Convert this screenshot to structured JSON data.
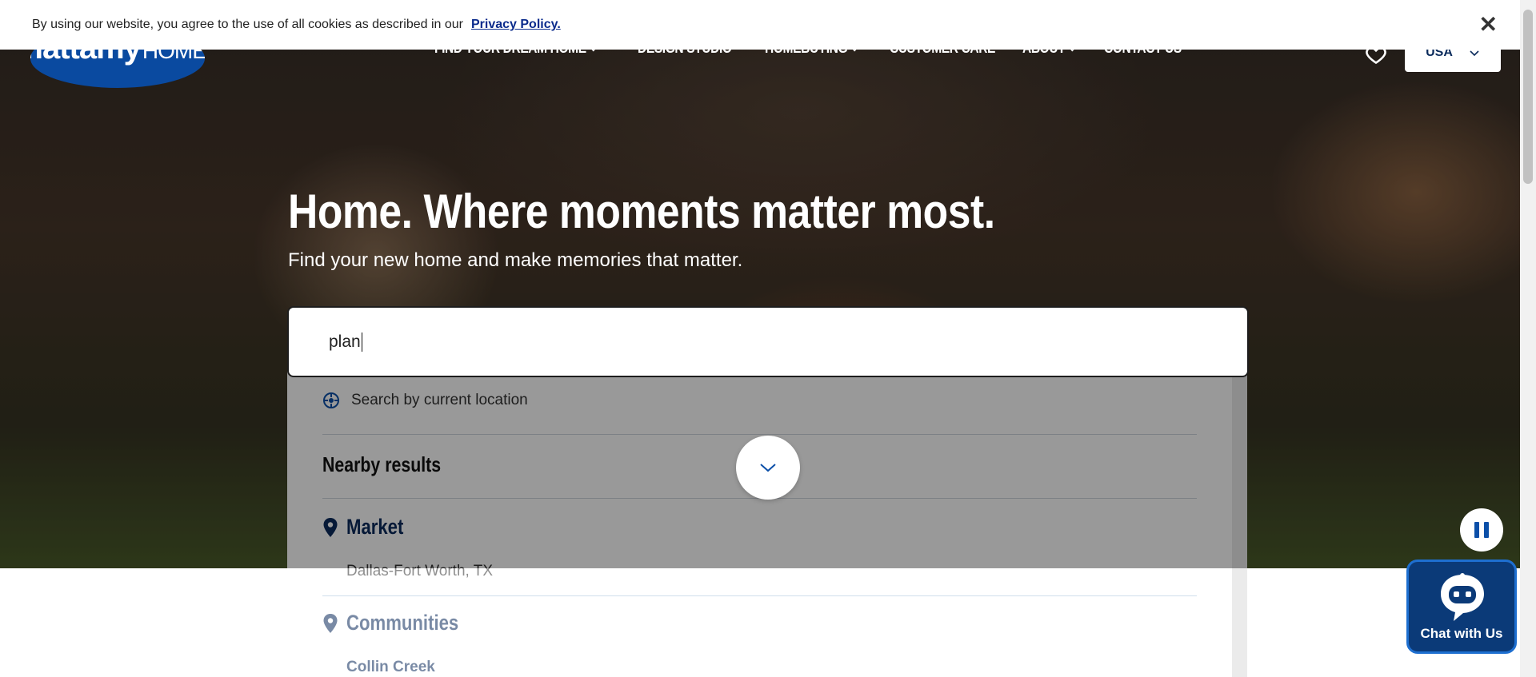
{
  "cookie_bar": {
    "text": "By using our website, you agree to the use of all cookies as described in our",
    "link": "Privacy Policy.",
    "close_icon": "close-icon"
  },
  "header": {
    "logo_main": "mattamy",
    "logo_sub": "HOMES",
    "nav": [
      {
        "label": "FIND YOUR DREAM HOME",
        "has_dropdown": true
      },
      {
        "label": "DESIGN STUDIO",
        "has_dropdown": false
      },
      {
        "label": "HOMEBUYING",
        "has_dropdown": true
      },
      {
        "label": "CUSTOMER CARE",
        "has_dropdown": false
      },
      {
        "label": "ABOUT",
        "has_dropdown": true
      },
      {
        "label": "CONTACT US",
        "has_dropdown": false
      }
    ],
    "country": "USA"
  },
  "hero": {
    "headline": "Home. Where moments matter most.",
    "subhead": "Find your new home and make memories that matter."
  },
  "search": {
    "value": "plan"
  },
  "dropdown": {
    "current_location": "Search by current location",
    "nearby_title": "Nearby results",
    "market_label": "Market",
    "market_items": [
      "Dallas-Fort Worth, TX"
    ],
    "communities_label": "Communities",
    "community_items": [
      "Collin Creek"
    ]
  },
  "chat": {
    "label": "Chat with Us"
  },
  "colors": {
    "brand_blue": "#0b2b5c",
    "accent_blue": "#0b4fa8"
  }
}
